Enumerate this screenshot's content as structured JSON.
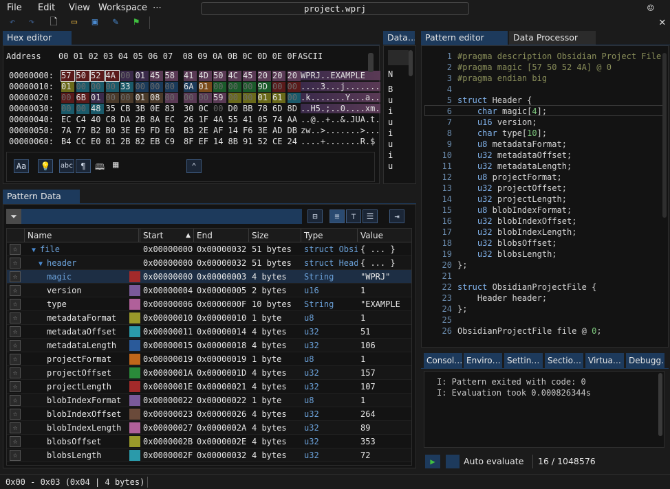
{
  "menu": {
    "file": "File",
    "edit": "Edit",
    "view": "View",
    "workspace": "Workspace",
    "more": "⋯"
  },
  "window": {
    "title": "project.wprj"
  },
  "hex_editor": {
    "tab": "Hex editor",
    "address_label": "Address",
    "column_header": "00 01 02 03 04 05 06 07  08 09 0A 0B 0C 0D 0E 0F",
    "ascii_label": "ASCII",
    "rows": [
      {
        "addr": "00000000:",
        "bytes": [
          "57",
          "50",
          "52",
          "4A",
          "00",
          "01",
          "45",
          "58",
          "41",
          "4D",
          "50",
          "4C",
          "45",
          "20",
          "20",
          "20"
        ],
        "ascii": "WPRJ..EXAMPLE   "
      },
      {
        "addr": "00000010:",
        "bytes": [
          "01",
          "00",
          "00",
          "00",
          "33",
          "00",
          "00",
          "00",
          "6A",
          "01",
          "00",
          "00",
          "00",
          "9D",
          "00",
          "00"
        ],
        "ascii": "....3...j......."
      },
      {
        "addr": "00000020:",
        "bytes": [
          "00",
          "6B",
          "01",
          "00",
          "00",
          "01",
          "08",
          "00",
          "00",
          "00",
          "59",
          "00",
          "00",
          "01",
          "61",
          "00"
        ],
        "ascii": ".k.......Y...a.."
      },
      {
        "addr": "00000030:",
        "bytes": [
          "00",
          "00",
          "48",
          "35",
          "CB",
          "3B",
          "0E",
          "83",
          "30",
          "0C",
          "00",
          "D0",
          "BB",
          "78",
          "6D",
          "8D"
        ],
        "ascii": "..H5.;..0....xm."
      },
      {
        "addr": "00000040:",
        "bytes": [
          "EC",
          "C4",
          "40",
          "C8",
          "DA",
          "2B",
          "8A",
          "EC",
          "26",
          "1F",
          "4A",
          "55",
          "41",
          "05",
          "74",
          "AA"
        ],
        "ascii": "..@..+..&.JUA.t."
      },
      {
        "addr": "00000050:",
        "bytes": [
          "7A",
          "77",
          "B2",
          "B0",
          "3E",
          "E9",
          "FD",
          "E0",
          "B3",
          "2E",
          "AF",
          "14",
          "F6",
          "3E",
          "AD",
          "DB"
        ],
        "ascii": "zw..>.......>..."
      },
      {
        "addr": "00000060:",
        "bytes": [
          "B4",
          "CC",
          "E0",
          "81",
          "2B",
          "82",
          "EB",
          "C9",
          "8F",
          "EF",
          "14",
          "8B",
          "91",
          "52",
          "CE",
          "24"
        ],
        "ascii": "....+.......R.$"
      }
    ]
  },
  "data_inspector": {
    "tab": "Data…",
    "col": "N",
    "rows": [
      "B",
      "u",
      "i",
      "u",
      "i",
      "u",
      "i",
      "u"
    ]
  },
  "pattern_data": {
    "tab": "Pattern Data",
    "columns": [
      "Name",
      "Start",
      "End",
      "Size",
      "Type",
      "Value"
    ],
    "rows": [
      {
        "name": "file",
        "indent": 1,
        "expander": "▼",
        "start": "0x00000000",
        "end": "0x00000032",
        "size": "51 bytes",
        "type": "struct Obsi",
        "value": "{ ... }",
        "color": ""
      },
      {
        "name": "header",
        "indent": 2,
        "expander": "▼",
        "start": "0x00000000",
        "end": "0x00000032",
        "size": "51 bytes",
        "type": "struct Head",
        "value": "{ ... }",
        "color": ""
      },
      {
        "name": "magic",
        "indent": 3,
        "expander": "",
        "start": "0x00000000",
        "end": "0x00000003",
        "size": "4 bytes",
        "type": "String",
        "value": "\"WPRJ\"",
        "color": "#a32a2a"
      },
      {
        "name": "version",
        "indent": 3,
        "expander": "",
        "start": "0x00000004",
        "end": "0x00000005",
        "size": "2 bytes",
        "type": "u16",
        "value": "1",
        "color": "#7a5a9a"
      },
      {
        "name": "type",
        "indent": 3,
        "expander": "",
        "start": "0x00000006",
        "end": "0x0000000F",
        "size": "10 bytes",
        "type": "String",
        "value": "\"EXAMPLE",
        "color": "#b0609a"
      },
      {
        "name": "metadataFormat",
        "indent": 3,
        "expander": "",
        "start": "0x00000010",
        "end": "0x00000010",
        "size": "1 byte",
        "type": "u8",
        "value": "1",
        "color": "#9a9a2a"
      },
      {
        "name": "metadataOffset",
        "indent": 3,
        "expander": "",
        "start": "0x00000011",
        "end": "0x00000014",
        "size": "4 bytes",
        "type": "u32",
        "value": "51",
        "color": "#2a9aaa"
      },
      {
        "name": "metadataLength",
        "indent": 3,
        "expander": "",
        "start": "0x00000015",
        "end": "0x00000018",
        "size": "4 bytes",
        "type": "u32",
        "value": "106",
        "color": "#2a5a9a"
      },
      {
        "name": "projectFormat",
        "indent": 3,
        "expander": "",
        "start": "0x00000019",
        "end": "0x00000019",
        "size": "1 byte",
        "type": "u8",
        "value": "1",
        "color": "#c0661a"
      },
      {
        "name": "projectOffset",
        "indent": 3,
        "expander": "",
        "start": "0x0000001A",
        "end": "0x0000001D",
        "size": "4 bytes",
        "type": "u32",
        "value": "157",
        "color": "#2a8a3a"
      },
      {
        "name": "projectLength",
        "indent": 3,
        "expander": "",
        "start": "0x0000001E",
        "end": "0x00000021",
        "size": "4 bytes",
        "type": "u32",
        "value": "107",
        "color": "#a32a2a"
      },
      {
        "name": "blobIndexFormat",
        "indent": 3,
        "expander": "",
        "start": "0x00000022",
        "end": "0x00000022",
        "size": "1 byte",
        "type": "u8",
        "value": "1",
        "color": "#7a5a9a"
      },
      {
        "name": "blobIndexOffset",
        "indent": 3,
        "expander": "",
        "start": "0x00000023",
        "end": "0x00000026",
        "size": "4 bytes",
        "type": "u32",
        "value": "264",
        "color": "#6a4a3a"
      },
      {
        "name": "blobIndexLength",
        "indent": 3,
        "expander": "",
        "start": "0x00000027",
        "end": "0x0000002A",
        "size": "4 bytes",
        "type": "u32",
        "value": "89",
        "color": "#b0609a"
      },
      {
        "name": "blobsOffset",
        "indent": 3,
        "expander": "",
        "start": "0x0000002B",
        "end": "0x0000002E",
        "size": "4 bytes",
        "type": "u32",
        "value": "353",
        "color": "#9a9a2a"
      },
      {
        "name": "blobsLength",
        "indent": 3,
        "expander": "",
        "start": "0x0000002F",
        "end": "0x00000032",
        "size": "4 bytes",
        "type": "u32",
        "value": "72",
        "color": "#2a9aaa"
      }
    ]
  },
  "pattern_editor": {
    "tab": "Pattern editor",
    "tab2": "Data Processor",
    "lines": [
      "#pragma description Obsidian Project File",
      "#pragma magic [57 50 52 4A] @ 0",
      "#pragma endian big",
      "",
      "struct Header {",
      "    char magic[4];",
      "    u16 version;",
      "    char type[10];",
      "    u8 metadataFormat;",
      "    u32 metadataOffset;",
      "    u32 metadataLength;",
      "    u8 projectFormat;",
      "    u32 projectOffset;",
      "    u32 projectLength;",
      "    u8 blobIndexFormat;",
      "    u32 blobIndexOffset;",
      "    u32 blobIndexLength;",
      "    u32 blobsOffset;",
      "    u32 blobsLength;",
      "};",
      "",
      "struct ObsidianProjectFile {",
      "    Header header;",
      "};",
      "",
      "ObsidianProjectFile file @ 0;"
    ]
  },
  "console": {
    "tabs": [
      "Consol…",
      "Enviro…",
      "Settin…",
      "Sectio…",
      "Virtua…",
      "Debugg…"
    ],
    "lines": [
      "I: Pattern exited with code: 0",
      "I: Evaluation took 0.000826344s"
    ],
    "auto_evaluate": "Auto evaluate",
    "counter": "16 / 1048576"
  },
  "status": {
    "selection": "0x00 - 0x03 (0x04 | 4 bytes)"
  },
  "colors": {
    "accent": "#1d3a5c",
    "keyword": "#7fb0e8",
    "comment": "#8a8f5a",
    "number": "#7ec97e"
  }
}
